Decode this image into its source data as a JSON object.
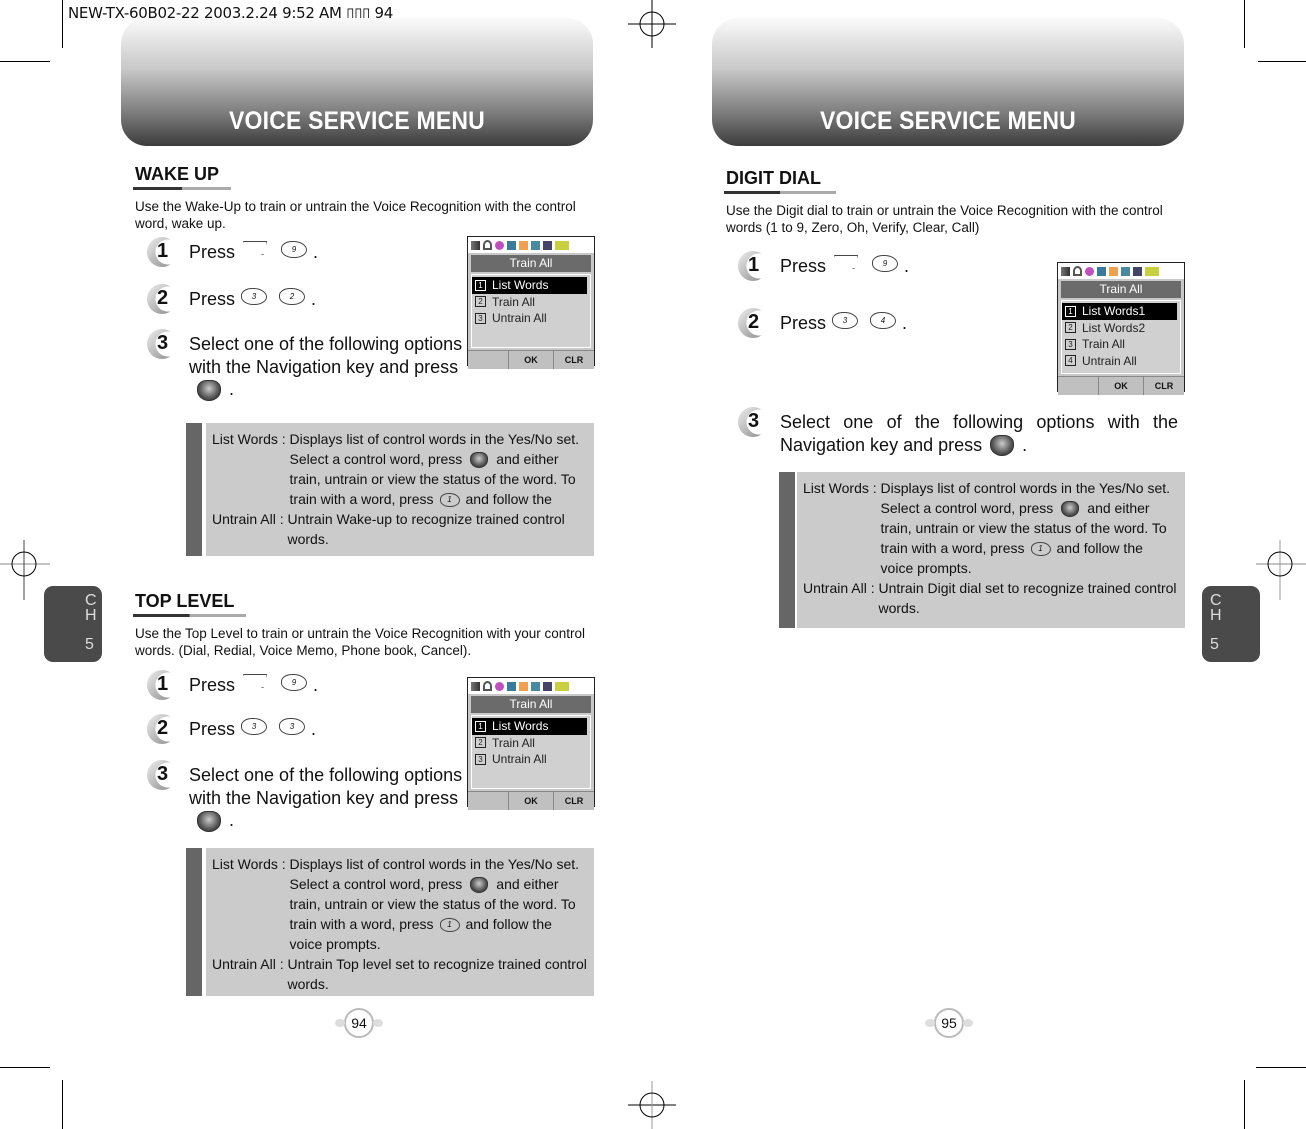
{
  "slug": "NEW-TX-60B02-22  2003.2.24 9:52 AM  ▯▯▯ 94",
  "left_page": {
    "header": "VOICE SERVICE MENU",
    "chapter_tab": {
      "c": "C",
      "h": "H",
      "num": "5"
    },
    "page_number": "94",
    "wake_up": {
      "title": "WAKE UP",
      "intro": "Use the Wake-Up to train or untrain the Voice Recognition with the control word, wake up.",
      "steps": [
        {
          "num": "1",
          "text": "Press",
          "keys": [
            "softkey-left",
            "9wxyz"
          ],
          "end": "."
        },
        {
          "num": "2",
          "text": "Press",
          "keys": [
            "3def",
            "2abc"
          ],
          "end": "."
        },
        {
          "num": "3",
          "text": "Select one of the following options with the Navigation key and press",
          "end": "."
        }
      ],
      "phone": {
        "title": "Train All",
        "items": [
          {
            "n": "1",
            "label": "List Words",
            "selected": true
          },
          {
            "n": "2",
            "label": "Train All"
          },
          {
            "n": "3",
            "label": "Untrain All"
          }
        ],
        "soft_ok": "OK",
        "soft_clr": "CLR"
      },
      "notes": {
        "list_term": "List Words : ",
        "list_desc_a": "Displays list of control words in the Yes/No set. Select a control word, press",
        "list_desc_b": "and either train, untrain or view the status of the word. To train with a word, press",
        "list_desc_c": "and follow the",
        "untrain_term": "Untrain All : ",
        "untrain_desc": "Untrain Wake-up to recognize trained control words."
      }
    },
    "top_level": {
      "title": "TOP LEVEL",
      "intro": "Use the Top Level to train or untrain the Voice Recognition with your control words. (Dial, Redial, Voice Memo, Phone book, Cancel).",
      "steps": [
        {
          "num": "1",
          "text": "Press",
          "keys": [
            "softkey-left",
            "9wxyz"
          ],
          "end": "."
        },
        {
          "num": "2",
          "text": "Press",
          "keys": [
            "3def",
            "3def"
          ],
          "end": "."
        },
        {
          "num": "3",
          "text": "Select one of the following options with the Navigation key and press",
          "end": "."
        }
      ],
      "phone": {
        "title": "Train All",
        "items": [
          {
            "n": "1",
            "label": "List Words",
            "selected": true
          },
          {
            "n": "2",
            "label": "Train All"
          },
          {
            "n": "3",
            "label": "Untrain All"
          }
        ],
        "soft_ok": "OK",
        "soft_clr": "CLR"
      },
      "notes": {
        "list_term": "List Words : ",
        "list_desc_a": "Displays list of control words in the Yes/No set. Select a control word, press",
        "list_desc_b": "and either train, untrain or view the status of the word. To train with a word, press",
        "list_desc_c": "and follow the voice prompts.",
        "untrain_term": "Untrain All : ",
        "untrain_desc": "Untrain Top level set to recognize trained control words."
      }
    }
  },
  "right_page": {
    "header": "VOICE SERVICE MENU",
    "chapter_tab": {
      "c": "C",
      "h": "H",
      "num": "5"
    },
    "page_number": "95",
    "digit_dial": {
      "title": "DIGIT DIAL",
      "intro": "Use the Digit dial to train or untrain the Voice Recognition with the control words (1 to 9, Zero, Oh, Verify, Clear, Call)",
      "steps": [
        {
          "num": "1",
          "text": "Press",
          "keys": [
            "softkey-left",
            "9wxyz"
          ],
          "end": "."
        },
        {
          "num": "2",
          "text": "Press",
          "keys": [
            "3def",
            "4ghi"
          ],
          "end": "."
        },
        {
          "num": "3",
          "text": "Select one of the following options with the Navigation key and press",
          "end": "."
        }
      ],
      "phone": {
        "title": "Train All",
        "items": [
          {
            "n": "1",
            "label": "List Words1",
            "selected": true
          },
          {
            "n": "2",
            "label": "List Words2"
          },
          {
            "n": "3",
            "label": "Train All"
          },
          {
            "n": "4",
            "label": "Untrain All"
          }
        ],
        "soft_ok": "OK",
        "soft_clr": "CLR"
      },
      "notes": {
        "list_term": "List Words : ",
        "list_desc_a": "Displays list of control words in the Yes/No set. Select a control word, press",
        "list_desc_b": "and either train, untrain or view the status of the word. To train with a word, press",
        "list_desc_c": "and follow the voice prompts.",
        "untrain_term": "Untrain All : ",
        "untrain_desc": "Untrain Digit dial set to recognize trained control words."
      }
    }
  },
  "keys": {
    "9wxyz": "9",
    "3def": "3",
    "2abc": "2",
    "4ghi": "4",
    "1": "1"
  },
  "colors": {
    "tab_bg": "#4a4a4a",
    "note_bg": "#cbcbcb",
    "note_bar": "#666666",
    "phone_title": "#6b6b6b"
  }
}
